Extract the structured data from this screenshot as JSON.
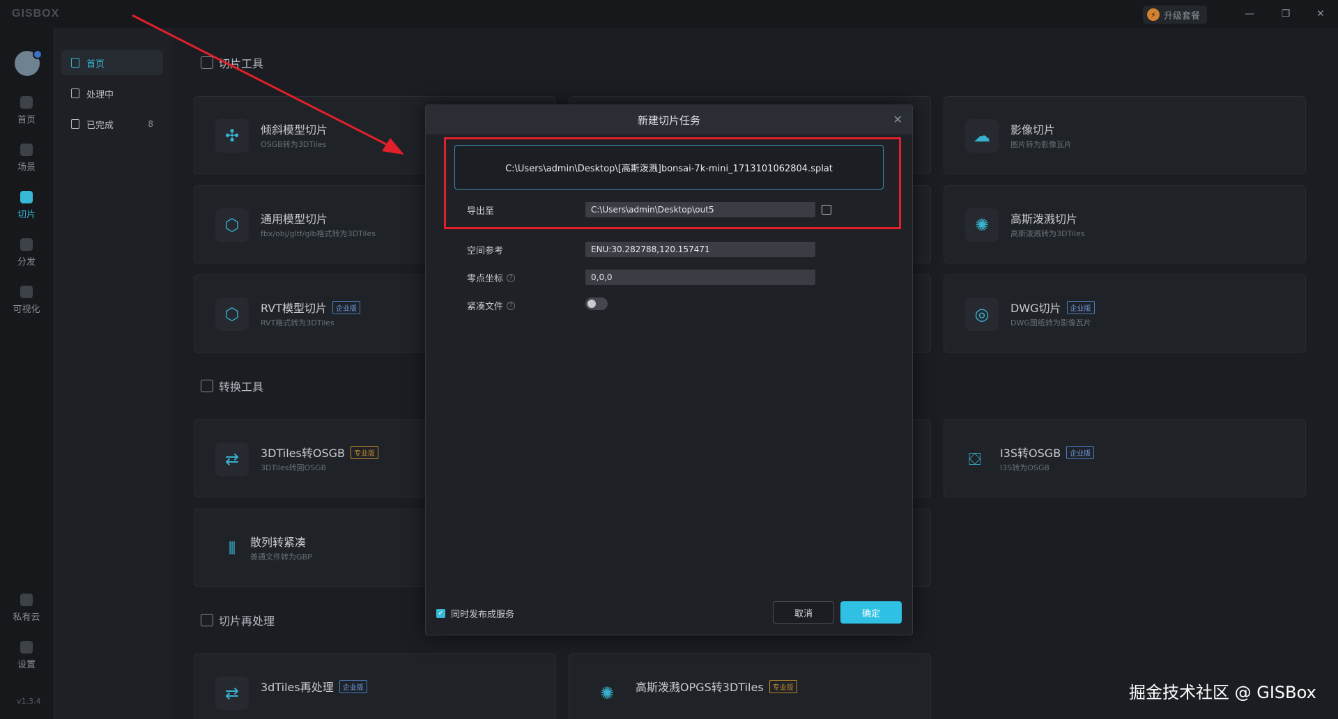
{
  "app": {
    "logo": "GISBOX",
    "upgrade_label": "升级套餐",
    "version": "v1.3.4"
  },
  "window": {
    "minimize": "—",
    "restore": "❐",
    "close": "✕"
  },
  "rail": {
    "items": [
      {
        "label": "首页"
      },
      {
        "label": "场景"
      },
      {
        "label": "切片"
      },
      {
        "label": "分发"
      },
      {
        "label": "可视化"
      },
      {
        "label": "私有云"
      },
      {
        "label": "设置"
      }
    ]
  },
  "subnav": {
    "items": [
      {
        "label": "首页"
      },
      {
        "label": "处理中"
      },
      {
        "label": "已完成",
        "count": "8"
      }
    ]
  },
  "sections": {
    "slice_tools": "切片工具",
    "convert_tools": "转换工具",
    "reprocess": "切片再处理"
  },
  "cards": {
    "oblique": {
      "title": "倾斜模型切片",
      "sub": "OSGB转为3DTiles"
    },
    "generic": {
      "title": "通用模型切片",
      "sub": "fbx/obj/gltf/glb格式转为3DTiles"
    },
    "rvt": {
      "title": "RVT模型切片",
      "tag": "企业版",
      "sub": "RVT格式转为3DTiles"
    },
    "imagery": {
      "title": "影像切片",
      "sub": "图片转为影像瓦片"
    },
    "gaussian": {
      "title": "高斯泼溅切片",
      "sub": "高斯泼溅转为3DTiles"
    },
    "dwg": {
      "title": "DWG切片",
      "tag": "企业版",
      "sub": "DWG图纸转为影像瓦片"
    },
    "tiles2osgb": {
      "title": "3DTiles转OSGB",
      "tag": "专业版",
      "sub": "3DTiles转回OSGB"
    },
    "i3s2osgb": {
      "title": "I3S转OSGB",
      "tag": "企业版",
      "sub": "I3S转为OSGB"
    },
    "scatter": {
      "title": "散列转紧凑",
      "sub": "普通文件转为GBP"
    },
    "tiles_reprocess": {
      "title": "3dTiles再处理",
      "tag": "企业版"
    },
    "gaussian_opgs": {
      "title": "高斯泼溅OPGS转3DTiles",
      "tag": "专业版"
    }
  },
  "modal": {
    "title": "新建切片任务",
    "close": "✕",
    "file_path": "C:\\Users\\admin\\Desktop\\[高斯泼溅]bonsai-7k-mini_1713101062804.splat",
    "export_label": "导出至",
    "export_value": "C:\\Users\\admin\\Desktop\\out5",
    "spatial_label": "空间参考",
    "spatial_value": "ENU:30.282788,120.157471",
    "origin_label": "零点坐标",
    "origin_value": "0,0,0",
    "compact_label": "紧凑文件",
    "compact_on": false,
    "publish_label": "同时发布成服务",
    "publish_checked": true,
    "cancel": "取消",
    "ok": "确定"
  },
  "watermark": "掘金技术社区 @ GISBox",
  "colors": {
    "accent": "#37b8d6",
    "highlight": "#e0202a"
  }
}
